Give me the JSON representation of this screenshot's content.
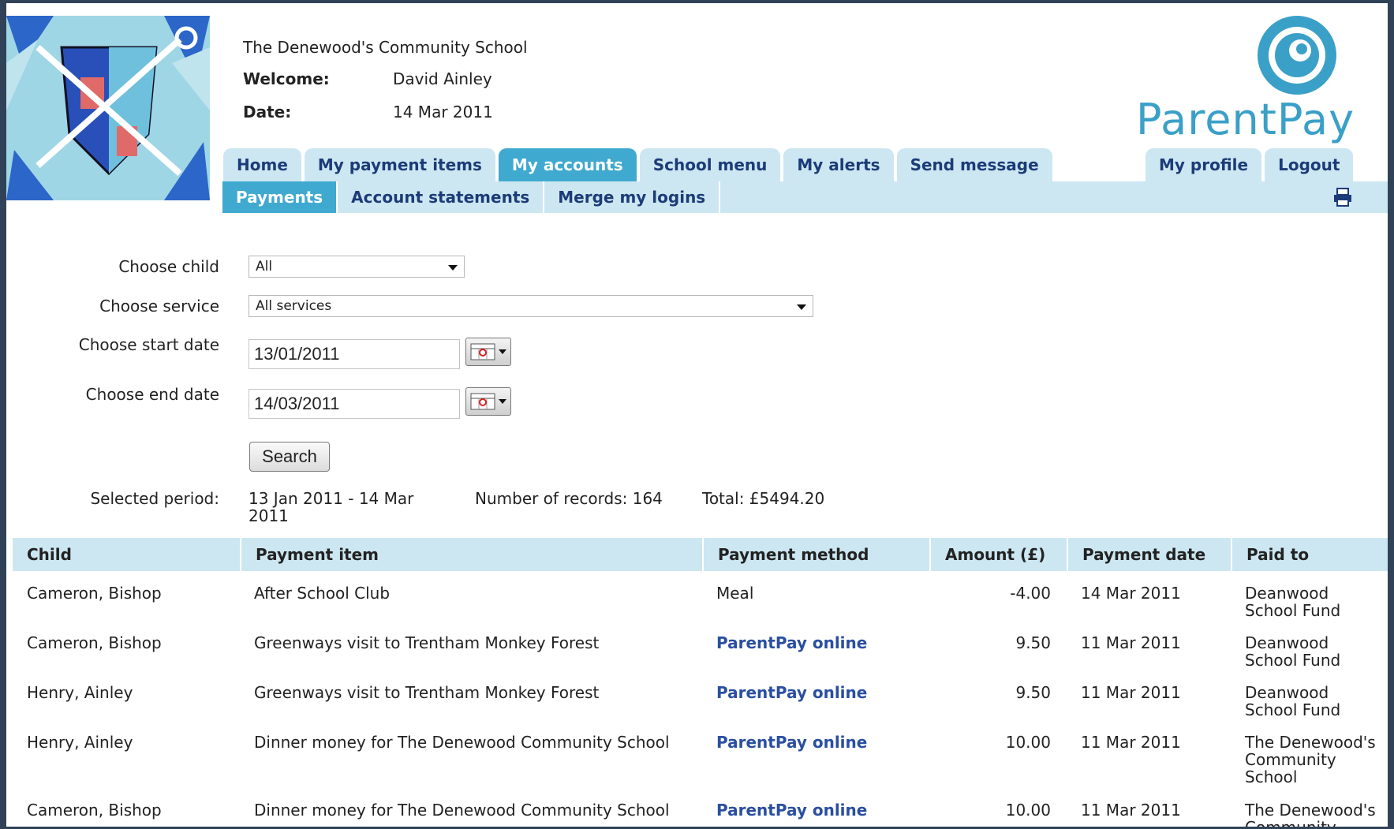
{
  "header": {
    "school_name": "The Denewood's Community School",
    "welcome_label": "Welcome:",
    "welcome_value": "David Ainley",
    "date_label": "Date:",
    "date_value": "14 Mar 2011",
    "brand": "ParentPay"
  },
  "nav": {
    "tabs": [
      "Home",
      "My payment items",
      "My accounts",
      "School menu",
      "My alerts",
      "Send message"
    ],
    "active_tab": "My accounts",
    "right_tabs": [
      "My profile",
      "Logout"
    ],
    "subtabs": [
      "Payments",
      "Account statements",
      "Merge my logins"
    ],
    "active_subtab": "Payments"
  },
  "filters": {
    "child_label": "Choose child",
    "child_value": "All",
    "service_label": "Choose service",
    "service_value": "All services",
    "start_label": "Choose start date",
    "start_value": "13/01/2011",
    "end_label": "Choose end date",
    "end_value": "14/03/2011",
    "search_label": "Search"
  },
  "summary": {
    "period_label": "Selected period:",
    "period_line1": "13 Jan 2011 - 14 Mar",
    "period_line2": "2011",
    "records_label": "Number of records: 164",
    "total_label": "Total: £5494.20"
  },
  "table": {
    "headers": [
      "Child",
      "Payment item",
      "Payment method",
      "Amount (£)",
      "Payment date",
      "Paid to"
    ],
    "rows": [
      {
        "child": "Cameron, Bishop",
        "item": "After School Club",
        "method": "Meal",
        "method_link": false,
        "amount": "-4.00",
        "date": "14 Mar 2011",
        "paid_to": [
          "Deanwood",
          "School Fund"
        ]
      },
      {
        "child": "Cameron, Bishop",
        "item": "Greenways visit to Trentham Monkey Forest",
        "method": "ParentPay online",
        "method_link": true,
        "amount": "9.50",
        "date": "11 Mar 2011",
        "paid_to": [
          "Deanwood",
          "School Fund"
        ]
      },
      {
        "child": "Henry, Ainley",
        "item": "Greenways visit to Trentham Monkey Forest",
        "method": "ParentPay online",
        "method_link": true,
        "amount": "9.50",
        "date": "11 Mar 2011",
        "paid_to": [
          "Deanwood",
          "School Fund"
        ]
      },
      {
        "child": "Henry, Ainley",
        "item": "Dinner money for The Denewood Community School",
        "method": "ParentPay online",
        "method_link": true,
        "amount": "10.00",
        "date": "11 Mar 2011",
        "paid_to": [
          "The Denewood's",
          "Community",
          "School"
        ]
      },
      {
        "child": "Cameron, Bishop",
        "item": "Dinner money for The Denewood Community School",
        "method": "ParentPay online",
        "method_link": true,
        "amount": "10.00",
        "date": "11 Mar 2011",
        "paid_to": [
          "The Denewood's",
          "Community"
        ]
      }
    ]
  }
}
